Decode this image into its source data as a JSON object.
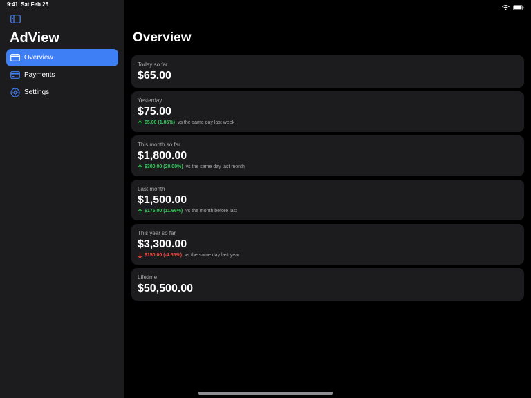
{
  "status_bar": {
    "time": "9:41",
    "date": "Sat Feb 25",
    "icons": [
      "wifi-icon",
      "battery-icon"
    ]
  },
  "sidebar": {
    "title": "AdView",
    "items": [
      {
        "label": "Overview",
        "icon": "card-icon",
        "active": true
      },
      {
        "label": "Payments",
        "icon": "creditcard-icon",
        "active": false
      },
      {
        "label": "Settings",
        "icon": "gear-icon",
        "active": false
      }
    ]
  },
  "main": {
    "title": "Overview",
    "cards": [
      {
        "label": "Today so far",
        "value": "$65.00"
      },
      {
        "label": "Yesterday",
        "value": "$75.00",
        "change_amount": "$5.00 (1.85%)",
        "change_direction": "up",
        "change_context": "vs the same day last week"
      },
      {
        "label": "This month so far",
        "value": "$1,800.00",
        "change_amount": "$300.00 (20.00%)",
        "change_direction": "up",
        "change_context": "vs the same day last month"
      },
      {
        "label": "Last month",
        "value": "$1,500.00",
        "change_amount": "$175.00 (11.66%)",
        "change_direction": "up",
        "change_context": "vs the month before last"
      },
      {
        "label": "This year so far",
        "value": "$3,300.00",
        "change_amount": "$150.00 (-4.55%)",
        "change_direction": "down",
        "change_context": "vs the same day last year"
      },
      {
        "label": "Lifetime",
        "value": "$50,500.00"
      }
    ]
  },
  "colors": {
    "accent": "#3f7ff5",
    "positive": "#34c759",
    "negative": "#ff453a",
    "sidebar_bg": "#1c1c1e",
    "card_bg": "#1c1c1e",
    "background": "#000000"
  }
}
